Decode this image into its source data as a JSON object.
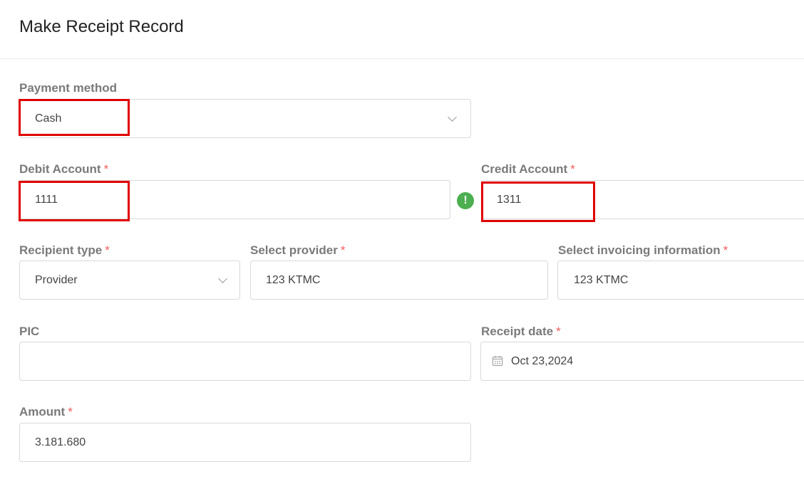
{
  "title": "Make Receipt Record",
  "required_mark": "*",
  "payment_method": {
    "label": "Payment method",
    "value": "Cash"
  },
  "debit_account": {
    "label": "Debit Account",
    "value": "1111"
  },
  "validation_icon_glyph": "!",
  "credit_account": {
    "label": "Credit Account",
    "value": "1311"
  },
  "recipient_type": {
    "label": "Recipient type",
    "value": "Provider"
  },
  "select_provider": {
    "label": "Select provider",
    "value": "123 KTMC"
  },
  "invoicing_info": {
    "label": "Select invoicing information",
    "value": "123 KTMC"
  },
  "pic": {
    "label": "PIC",
    "value": ""
  },
  "receipt_date": {
    "label": "Receipt date",
    "value": "Oct 23,2024"
  },
  "amount": {
    "label": "Amount",
    "value": "3.181.680"
  },
  "colors": {
    "highlight": "#e00000",
    "required": "#f25c5c",
    "valid_icon": "#4caf50",
    "label": "#7a7a7a",
    "border": "#d9d9d9"
  },
  "icons": {
    "dropdown": "chevron-down-icon",
    "calendar": "calendar-icon",
    "validation": "exclamation-circle-icon"
  }
}
